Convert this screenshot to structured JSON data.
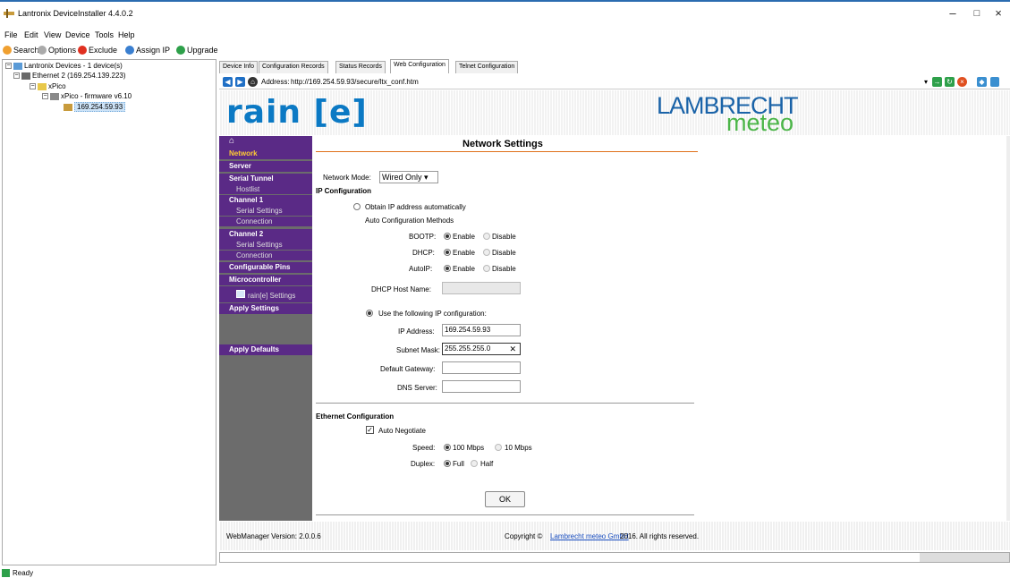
{
  "window": {
    "title": "Lantronix DeviceInstaller 4.4.0.2",
    "minimize": "–",
    "maximize": "□",
    "close": "×"
  },
  "menu": [
    "File",
    "Edit",
    "View",
    "Device",
    "Tools",
    "Help"
  ],
  "toolbar": {
    "search": "Search",
    "options": "Options",
    "exclude": "Exclude",
    "assign_ip": "Assign IP",
    "upgrade": "Upgrade"
  },
  "tree": {
    "root": "Lantronix Devices - 1 device(s)",
    "ethernet": "Ethernet 2 (169.254.139.223)",
    "xpico": "xPico",
    "firmware": "xPico - firmware v6.10",
    "device_ip": "169.254.59.93"
  },
  "tabs": [
    "Device Info",
    "Configuration Records",
    "Status Records",
    "Web Configuration",
    "Telnet Configuration"
  ],
  "browser": {
    "address_label": "Address:",
    "url": "http://169.254.59.93/secure/ltx_conf.htm"
  },
  "banner": {
    "logo": "rain [e]",
    "brand_top": "LAMBRECHT",
    "brand_bottom": "meteo"
  },
  "nav": {
    "home": "⌂",
    "items": [
      {
        "label": "Network",
        "type": "item"
      },
      {
        "label": "Server",
        "type": "item"
      },
      {
        "label": "Serial Tunnel",
        "type": "item"
      },
      {
        "label": "Hostlist",
        "type": "sub"
      },
      {
        "label": "Channel 1",
        "type": "item"
      },
      {
        "label": "Serial Settings",
        "type": "sub"
      },
      {
        "label": "Connection",
        "type": "sub"
      },
      {
        "label": "Channel 2",
        "type": "item"
      },
      {
        "label": "Serial Settings",
        "type": "sub"
      },
      {
        "label": "Connection",
        "type": "sub"
      },
      {
        "label": "Configurable Pins",
        "type": "item"
      },
      {
        "label": "Microcontroller",
        "type": "item"
      },
      {
        "label": "rain[e] Settings",
        "type": "sub"
      },
      {
        "label": "Apply Settings",
        "type": "item"
      },
      {
        "label": "Apply Defaults",
        "type": "item"
      }
    ]
  },
  "form": {
    "heading": "Network Settings",
    "network_mode_label": "Network Mode:",
    "network_mode_value": "Wired Only",
    "ip_config_heading": "IP Configuration",
    "obtain_auto": "Obtain IP address automatically",
    "auto_methods": "Auto Configuration Methods",
    "bootp_label": "BOOTP:",
    "dhcp_label": "DHCP:",
    "autoip_label": "AutoIP:",
    "enable": "Enable",
    "disable": "Disable",
    "dhcp_host_label": "DHCP Host Name:",
    "use_following": "Use the following IP configuration:",
    "ip_label": "IP Address:",
    "ip_value": "169.254.59.93",
    "subnet_label": "Subnet Mask:",
    "subnet_value": "255.255.255.0",
    "gateway_label": "Default Gateway:",
    "dns_label": "DNS Server:",
    "eth_heading": "Ethernet Configuration",
    "auto_negotiate": "Auto Negotiate",
    "speed_label": "Speed:",
    "speed_100": "100 Mbps",
    "speed_10": "10 Mbps",
    "duplex_label": "Duplex:",
    "full": "Full",
    "half": "Half",
    "ok": "OK",
    "clear_icon": "✕"
  },
  "footer": {
    "version": "WebManager Version: 2.0.0.6",
    "copyright_pre": "Copyright ©",
    "copyright_link": "Lambrecht meteo GmbH",
    "copyright_post": "2016. All rights reserved."
  },
  "status": "Ready"
}
